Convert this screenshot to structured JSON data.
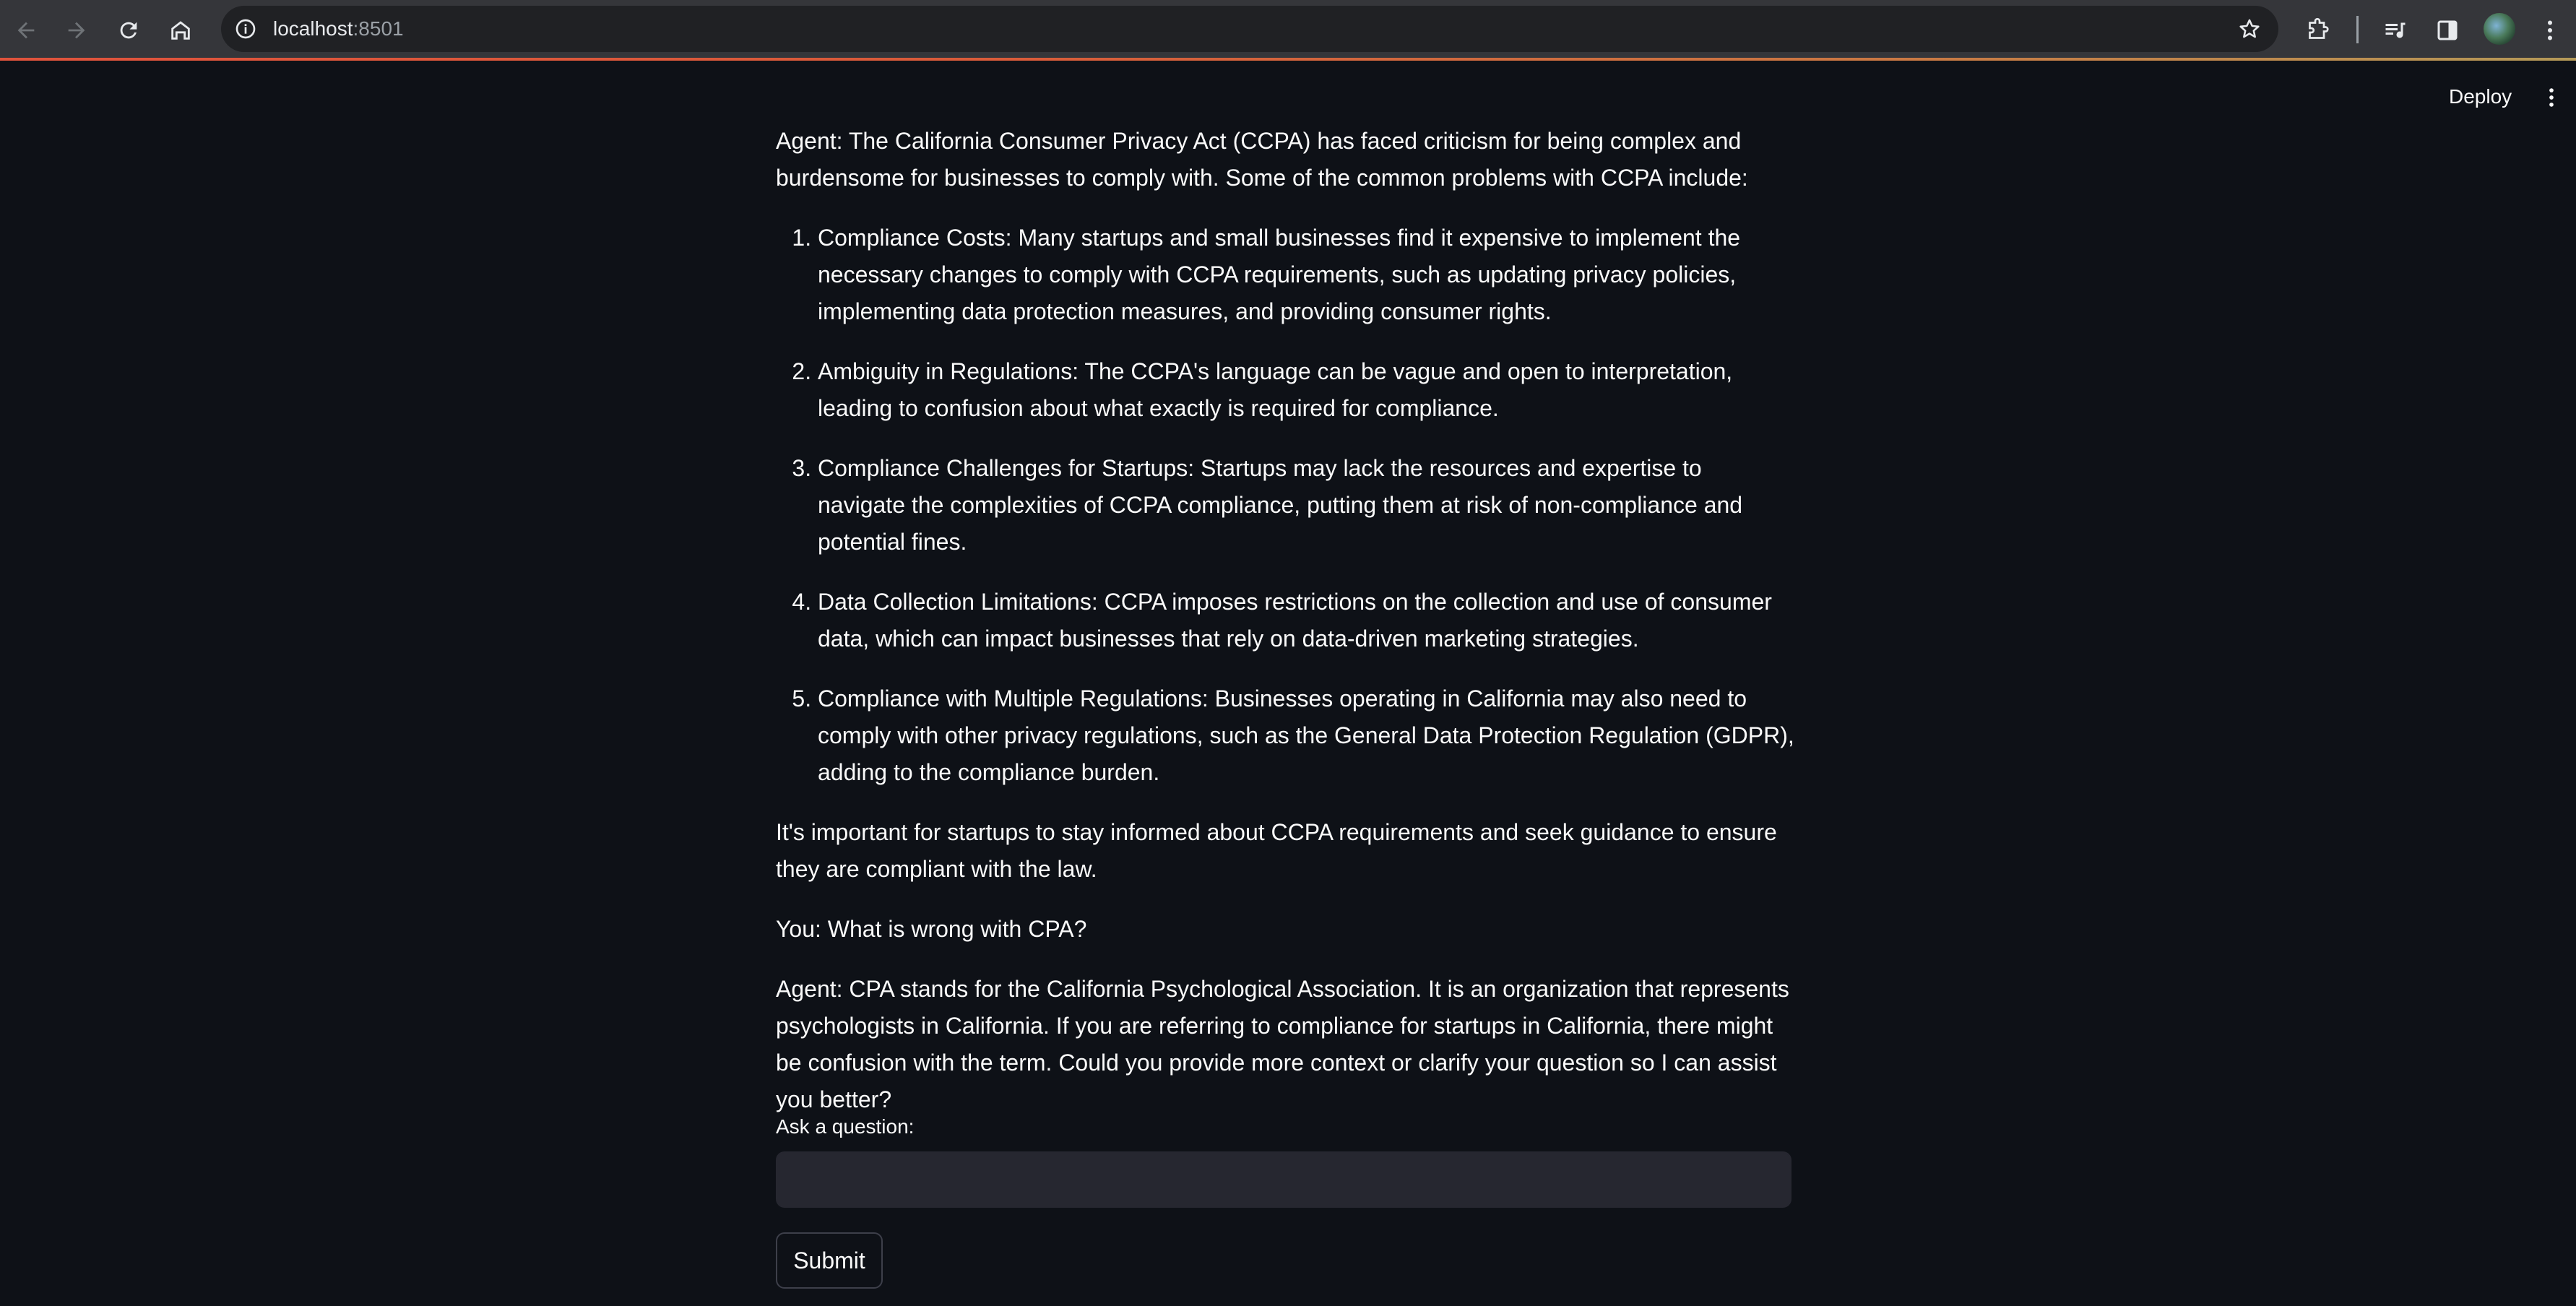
{
  "browser": {
    "url_host": "localhost",
    "url_port": ":8501",
    "icons": {
      "back": "arrow-left-icon",
      "forward": "arrow-right-icon",
      "reload": "reload-icon",
      "home": "home-icon",
      "site_info": "info-icon",
      "bookmark": "star-icon",
      "extensions": "puzzle-icon",
      "media": "media-queue-icon",
      "side_panel": "side-panel-icon",
      "profile": "avatar",
      "menu": "kebab-menu-icon"
    },
    "progress_color": "#e0533c"
  },
  "app": {
    "deploy_label": "Deploy",
    "menu_icon": "kebab-menu-icon"
  },
  "chat": {
    "agent_intro": "Agent: The California Consumer Privacy Act (CCPA) has faced criticism for being complex and burdensome for businesses to comply with. Some of the common problems with CCPA include:",
    "list": [
      "Compliance Costs: Many startups and small businesses find it expensive to implement the necessary changes to comply with CCPA requirements, such as updating privacy policies, implementing data protection measures, and providing consumer rights.",
      "Ambiguity in Regulations: The CCPA's language can be vague and open to interpretation, leading to confusion about what exactly is required for compliance.",
      "Compliance Challenges for Startups: Startups may lack the resources and expertise to navigate the complexities of CCPA compliance, putting them at risk of non-compliance and potential fines.",
      "Data Collection Limitations: CCPA imposes restrictions on the collection and use of consumer data, which can impact businesses that rely on data-driven marketing strategies.",
      "Compliance with Multiple Regulations: Businesses operating in California may also need to comply with other privacy regulations, such as the General Data Protection Regulation (GDPR), adding to the compliance burden."
    ],
    "agent_outro": "It's important for startups to stay informed about CCPA requirements and seek guidance to ensure they are compliant with the law.",
    "user_message": "You: What is wrong with CPA?",
    "agent_reply": "Agent: CPA stands for the California Psychological Association. It is an organization that represents psychologists in California. If you are referring to compliance for startups in California, there might be confusion with the term. Could you provide more context or clarify your question so I can assist you better?"
  },
  "form": {
    "question_label": "Ask a question:",
    "question_value": "",
    "submit_label": "Submit"
  },
  "colors": {
    "app_background": "#0e1117",
    "input_background": "#262730",
    "text": "#fafafa",
    "chrome_toolbar": "#35363a",
    "omnibox": "#202124"
  }
}
